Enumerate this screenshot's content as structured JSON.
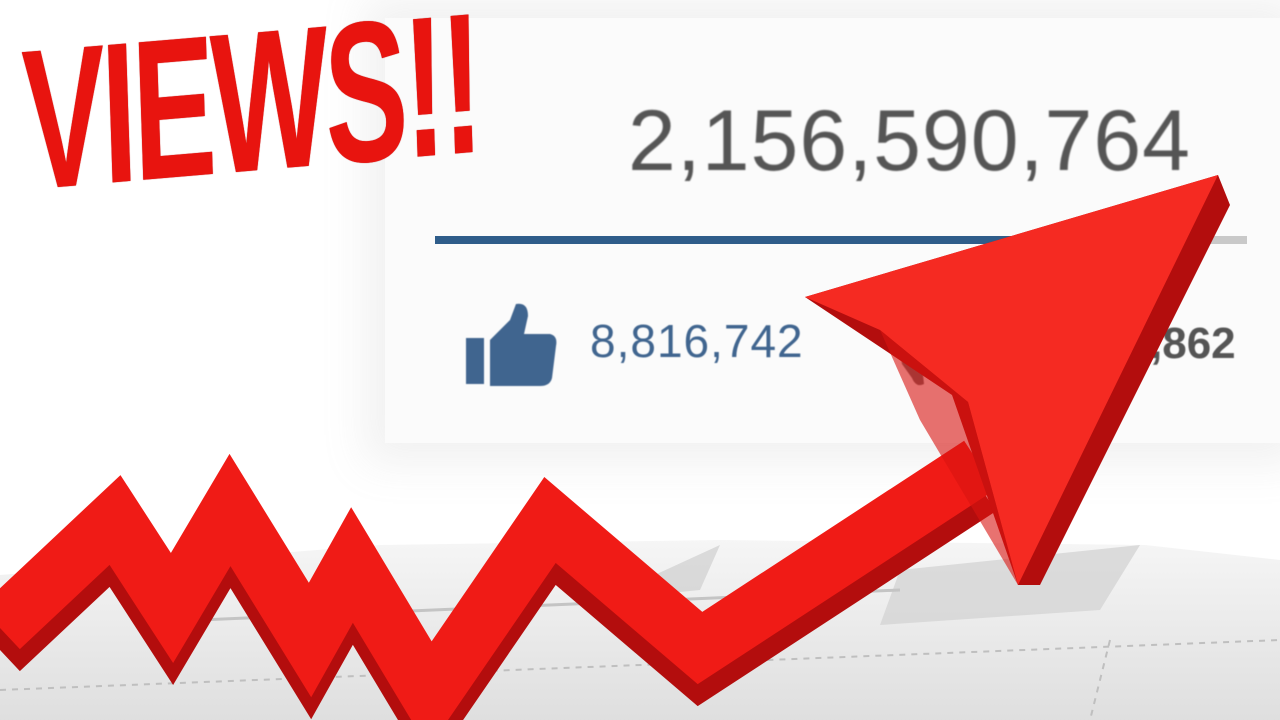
{
  "headline": "VIEWS!!",
  "stats": {
    "view_count": "2,156,590,764",
    "like_count": "8,816,742",
    "dislike_count_partial": ",862",
    "like_ratio": 0.86
  },
  "icons": {
    "like": "thumbs-up-icon",
    "dislike": "thumbs-down-icon",
    "arrow": "trend-up-arrow-icon"
  },
  "colors": {
    "headline": "#e8140f",
    "arrow_top": "#ff3b30",
    "arrow_side": "#c80f0f",
    "view_count": "#555555",
    "like_blue": "#40658f",
    "bar_fill": "#2f5d8a",
    "bar_track": "#c9c9c9"
  }
}
